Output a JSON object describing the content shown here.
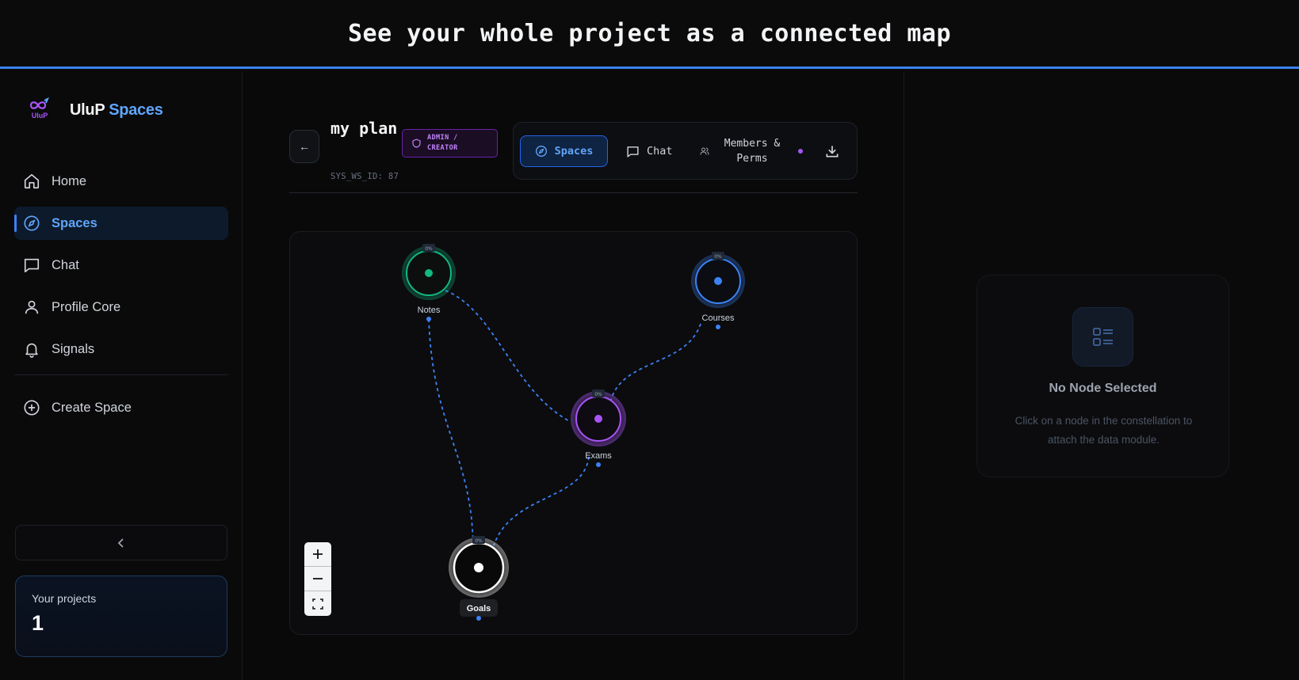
{
  "banner": {
    "title": "See your whole project as a connected map"
  },
  "brand": {
    "logo_text": "UluP",
    "name_part1": "UluP",
    "name_part2": "Spaces"
  },
  "sidebar": {
    "items": [
      {
        "label": "Home",
        "icon": "home-icon"
      },
      {
        "label": "Spaces",
        "icon": "compass-icon",
        "active": true
      },
      {
        "label": "Chat",
        "icon": "chat-icon"
      },
      {
        "label": "Profile Core",
        "icon": "user-icon"
      },
      {
        "label": "Signals",
        "icon": "bell-icon"
      }
    ],
    "create_label": "Create Space",
    "projects_label": "Your projects",
    "projects_count": "1"
  },
  "workspace": {
    "name": "my plan",
    "id_text": "SYS_WS_ID: 87",
    "role_badge": "ADMIN / CREATOR"
  },
  "tabs": {
    "spaces": "Spaces",
    "chat": "Chat",
    "members": "Members & Perms"
  },
  "graph": {
    "nodes": [
      {
        "id": "notes",
        "label": "Notes",
        "progress": "0%",
        "color": "#10b981"
      },
      {
        "id": "courses",
        "label": "Courses",
        "progress": "0%",
        "color": "#3b82f6"
      },
      {
        "id": "exams",
        "label": "Exams",
        "progress": "0%",
        "color": "#a855f7"
      },
      {
        "id": "goals",
        "label": "Goals",
        "progress": "0%",
        "color": "#ffffff"
      }
    ],
    "edges": [
      [
        "notes",
        "exams"
      ],
      [
        "notes",
        "goals"
      ],
      [
        "courses",
        "exams"
      ],
      [
        "exams",
        "goals"
      ]
    ],
    "edge_color": "#3b82f6"
  },
  "detail_panel": {
    "title": "No Node Selected",
    "description": "Click on a node in the constellation to attach the data module."
  },
  "colors": {
    "accent": "#3b82f6",
    "accent_light": "#60a5fa",
    "purple": "#a855f7",
    "green": "#10b981"
  }
}
